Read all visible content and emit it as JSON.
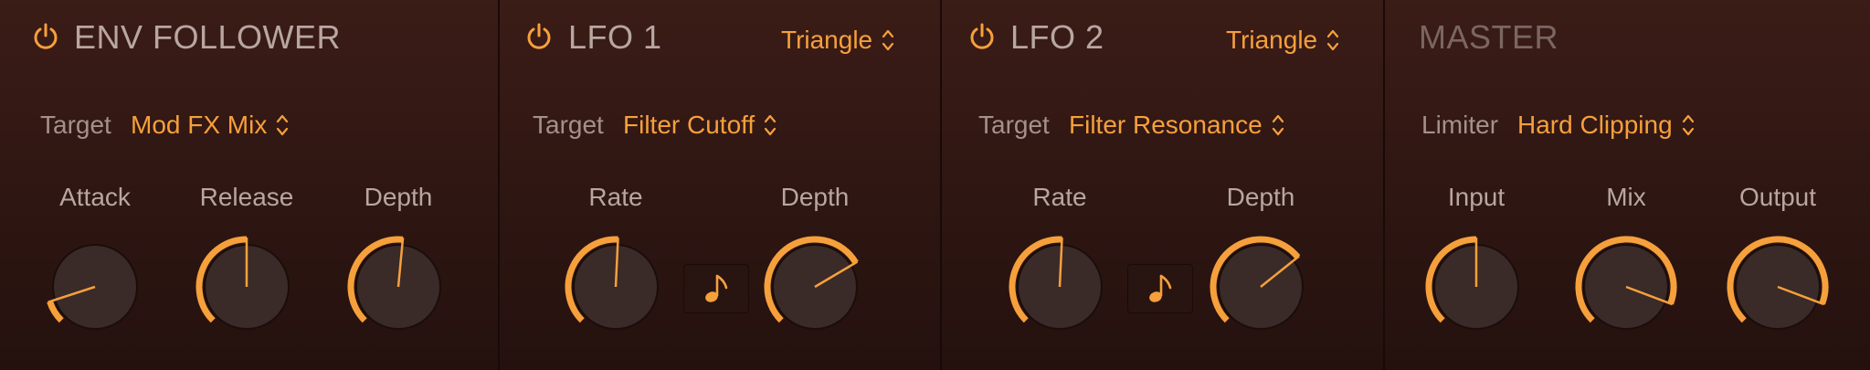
{
  "colors": {
    "accent": "#f6a03c",
    "label": "#a4918c",
    "title": "#b8a6a1",
    "knob_body": "#3a2a28",
    "background": "#2e1612"
  },
  "panels": {
    "env": {
      "title": "ENV FOLLOWER",
      "power_icon": "power-icon",
      "target_label": "Target",
      "target_value": "Mod FX Mix",
      "knobs": [
        {
          "label": "Attack",
          "value": 0.1
        },
        {
          "label": "Release",
          "value": 0.5
        },
        {
          "label": "Depth",
          "value": 0.52
        }
      ]
    },
    "lfo1": {
      "title": "LFO 1",
      "power_icon": "power-icon",
      "waveform": "Triangle",
      "target_label": "Target",
      "target_value": "Filter Cutoff",
      "sync_icon": "music-note-icon",
      "knobs": [
        {
          "label": "Rate",
          "value": 0.51
        },
        {
          "label": "Depth",
          "value": 0.72
        }
      ]
    },
    "lfo2": {
      "title": "LFO 2",
      "power_icon": "power-icon",
      "waveform": "Triangle",
      "target_label": "Target",
      "target_value": "Filter Resonance",
      "sync_icon": "music-note-icon",
      "knobs": [
        {
          "label": "Rate",
          "value": 0.51
        },
        {
          "label": "Depth",
          "value": 0.69
        }
      ]
    },
    "master": {
      "title": "MASTER",
      "limiter_label": "Limiter",
      "limiter_value": "Hard Clipping",
      "knobs": [
        {
          "label": "Input",
          "value": 0.5
        },
        {
          "label": "Mix",
          "value": 0.91
        },
        {
          "label": "Output",
          "value": 0.91
        }
      ]
    }
  }
}
